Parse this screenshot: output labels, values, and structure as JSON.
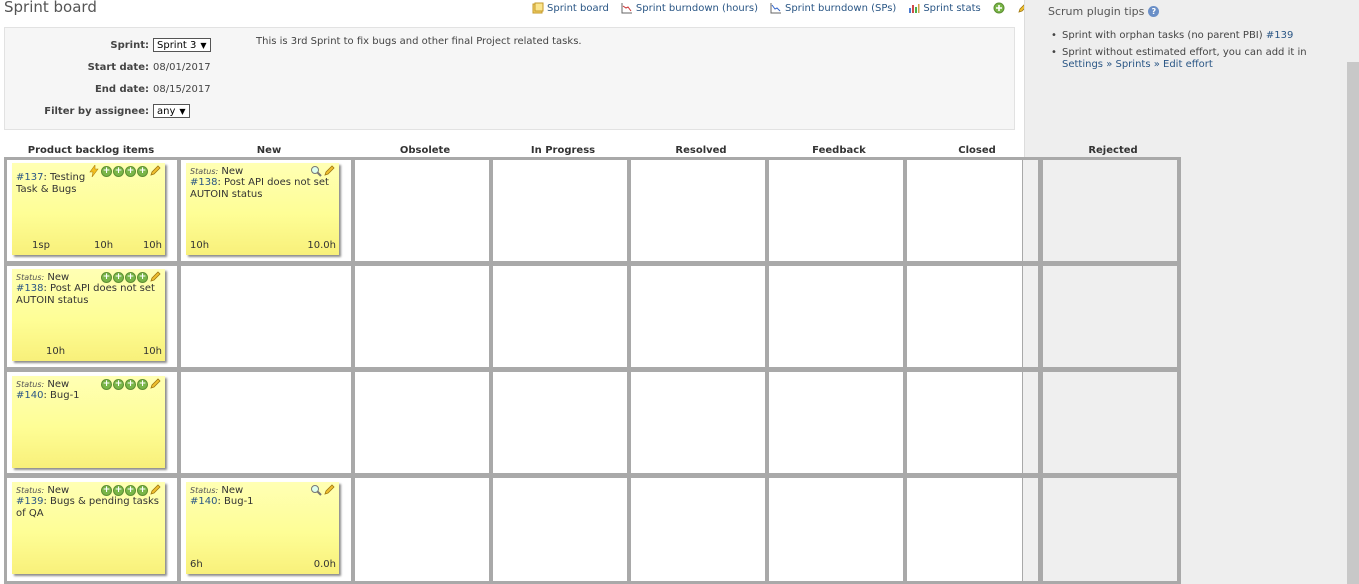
{
  "page_title": "Sprint board",
  "toolbar": {
    "sprint_board": "Sprint board",
    "burndown_hours": "Sprint burndown (hours)",
    "burndown_sps": "Sprint burndown (SPs)",
    "sprint_stats": "Sprint stats"
  },
  "info": {
    "sprint_label": "Sprint:",
    "sprint_value": "Sprint 3",
    "start_label": "Start date:",
    "start_value": "08/01/2017",
    "end_label": "End date:",
    "end_value": "08/15/2017",
    "assignee_label": "Filter by assignee:",
    "assignee_value": "any",
    "description": "This is 3rd Sprint to fix bugs and other final Project related tasks."
  },
  "sidebar": {
    "title": "Scrum plugin tips",
    "tip1_text": "Sprint with orphan tasks (no parent PBI)",
    "tip1_link": "#139",
    "tip2_text": "Sprint without estimated effort, you can add it in",
    "tip2_link": "Settings » Sprints » Edit effort"
  },
  "columns": [
    "Product backlog items",
    "New",
    "Obsolete",
    "In Progress",
    "Resolved",
    "Feedback",
    "Closed",
    "Rejected"
  ],
  "cards": {
    "r1_pbi": {
      "id": "#137",
      "title": ": Testing Task & Bugs",
      "sp": "1sp",
      "h1": "10h",
      "h2": "10h"
    },
    "r1_task": {
      "status_label": "Status:",
      "status": "New",
      "id": "#138",
      "title": ": Post API does not set AUTOIN status",
      "h1": "10h",
      "h2": "10.0h"
    },
    "r2_pbi": {
      "status_label": "Status:",
      "status": "New",
      "id": "#138",
      "title": ": Post API does not set AUTOIN status",
      "h1": "10h",
      "h2": "10h"
    },
    "r3_pbi": {
      "status_label": "Status:",
      "status": "New",
      "id": "#140",
      "title": ": Bug-1"
    },
    "r4_pbi": {
      "status_label": "Status:",
      "status": "New",
      "id": "#139",
      "title": ": Bugs & pending tasks of QA"
    },
    "r4_task": {
      "status_label": "Status:",
      "status": "New",
      "id": "#140",
      "title": ": Bug-1",
      "h1": "6h",
      "h2": "0.0h"
    }
  },
  "colors": {
    "postit": "#fefe96",
    "link": "#2a5685",
    "grid": "#a9a9a9",
    "plus": "#7ab648"
  }
}
